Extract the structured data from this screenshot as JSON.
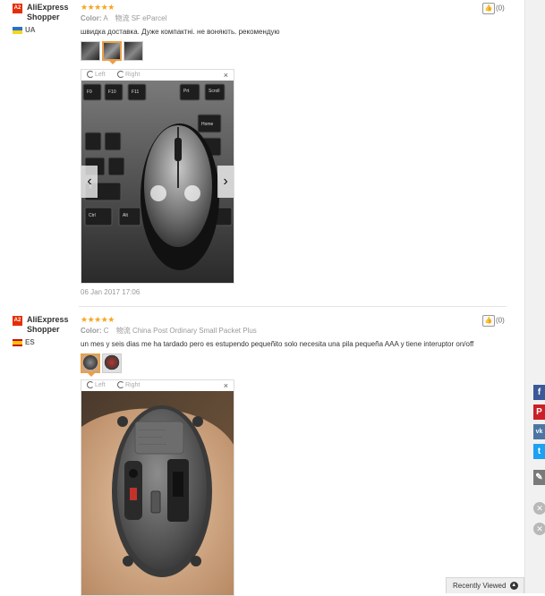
{
  "reviews": [
    {
      "user": {
        "badge": "A2",
        "name": "AliExpress Shopper",
        "country": "UA"
      },
      "rating_stars": "★★★★★",
      "color_label": "Color:",
      "color_value": "A",
      "shipping_label": "物流",
      "shipping_value": "SF eParcel",
      "text": "швидка доставка. Дуже компактні. не воняють. рекомендую",
      "helpful_count": "(0)",
      "viewer": {
        "rotate_left": "Left",
        "rotate_right": "Right",
        "close": "×",
        "prev": "‹",
        "next": "›"
      },
      "date": "06 Jan 2017 17:06"
    },
    {
      "user": {
        "badge": "A2",
        "name": "AliExpress Shopper",
        "country": "ES"
      },
      "rating_stars": "★★★★★",
      "color_label": "Color:",
      "color_value": "C",
      "shipping_label": "物流",
      "shipping_value": "China Post Ordinary Small Packet Plus",
      "text": "un mes y seis dias me ha tardado pero es estupendo pequeñito solo necesita una pila pequeña AAA y tiene interuptor on/off",
      "helpful_count": "(0)",
      "viewer": {
        "rotate_left": "Left",
        "rotate_right": "Right",
        "close": "×"
      }
    }
  ],
  "share": {
    "facebook": "f",
    "pinterest": "P",
    "vk": "vk",
    "twitter": "t",
    "edit": "✎"
  },
  "floating": {
    "close_1": "✕",
    "close_2": "✕"
  },
  "recently_viewed": {
    "label": "Recently Viewed",
    "arrow": "▲"
  },
  "colors": {
    "star": "#f5a623",
    "badge": "#e62e04",
    "accent_border": "#e8a04a"
  }
}
